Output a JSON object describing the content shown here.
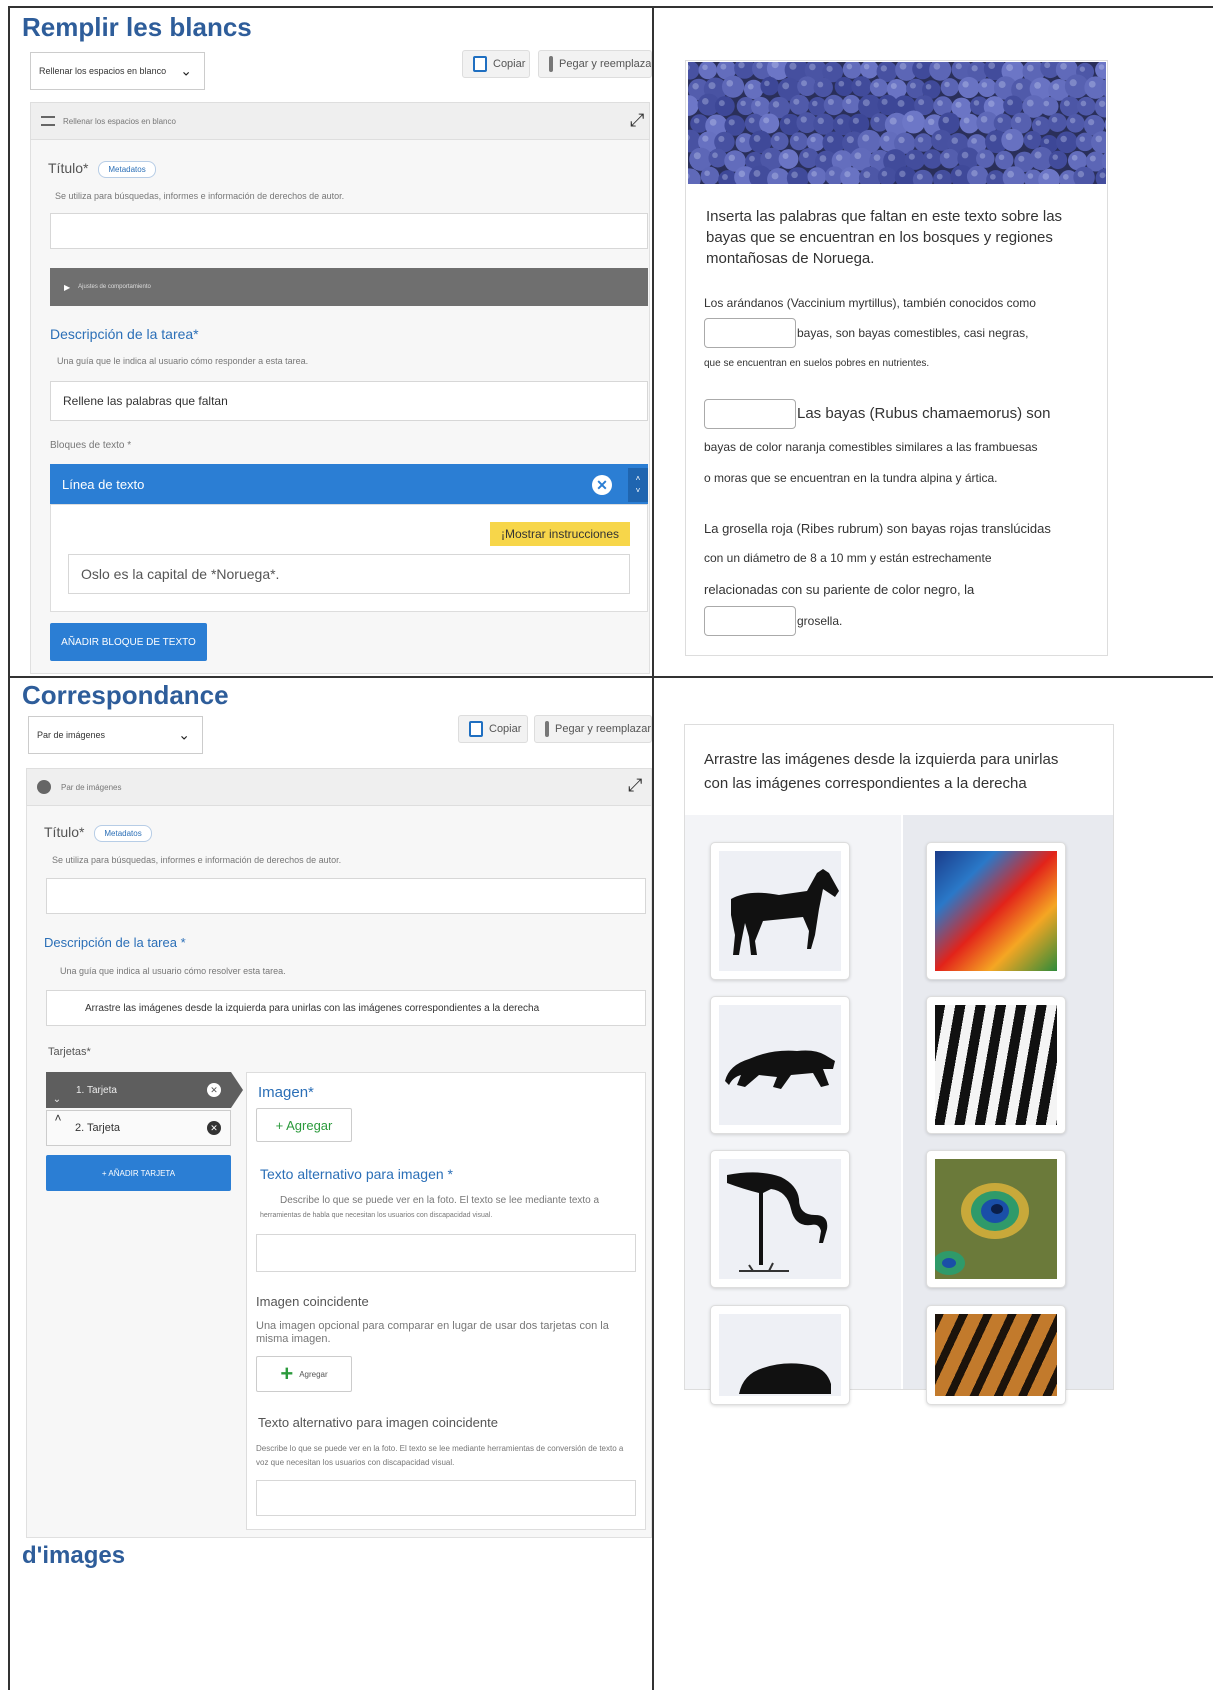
{
  "section1": {
    "title": "Remplir les blancs",
    "editor": {
      "select_value": "Rellenar los espacios en blanco",
      "copy_label": "Copiar",
      "paste_label": "Pegar y reemplazar",
      "header_label": "Rellenar los espacios en blanco",
      "title_label": "Título*",
      "metadata_label": "Metadatos",
      "title_hint": "Se utiliza para búsquedas, informes e información de derechos de autor.",
      "title_value": "",
      "settings_bar_label": "Ajustes de comportamiento",
      "task_desc_label": "Descripción de la tarea*",
      "task_desc_hint": "Una guía que le indica al usuario cómo responder a esta tarea.",
      "task_desc_value": "Rellene las palabras que faltan",
      "text_blocks_label": "Bloques de texto *",
      "text_line_label": "Línea de texto",
      "show_instructions_label": "¡Mostrar instrucciones",
      "text_line_value": "Oslo es la capital de *Noruega*.",
      "add_block_label": "AÑADIR BLOQUE DE TEXTO"
    },
    "preview": {
      "intro": "Inserta las palabras que faltan en este texto sobre las bayas que se encuentran en los bosques y regiones montañosas de Noruega.",
      "line1": "Los arándanos (Vaccinium myrtillus), también conocidos como",
      "line2": "bayas, son bayas comestibles, casi negras,",
      "line3": "que se encuentran en suelos pobres en nutrientes.",
      "line4": "Las bayas (Rubus chamaemorus) son",
      "line5": "bayas de color naranja comestibles similares a las frambuesas",
      "line6": "o moras que se encuentran en la tundra alpina y ártica.",
      "line7": "La grosella roja (Ribes rubrum) son bayas rojas translúcidas",
      "line8": "con un diámetro de 8 a 10 mm y están estrechamente",
      "line9": "relacionadas con su pariente de color negro, la",
      "line10": "grosella."
    }
  },
  "section2": {
    "title": "Correspondance",
    "footer_title": "d'images",
    "editor": {
      "select_value": "Par de imágenes",
      "copy_label": "Copiar",
      "paste_label": "Pegar y reemplazar",
      "header_label": "Par de imágenes",
      "title_label": "Título*",
      "metadata_label": "Metadatos",
      "title_hint": "Se utiliza para búsquedas, informes e información de derechos de autor.",
      "title_value": "",
      "task_desc_label": "Descripción de la tarea *",
      "task_desc_hint": "Una guía que indica al usuario cómo resolver esta tarea.",
      "task_desc_value": "Arrastre las imágenes desde la izquierda para unirlas con las imágenes correspondientes a la derecha",
      "cards_label": "Tarjetas*",
      "card1_label": "1. Tarjeta",
      "card2_label": "2. Tarjeta",
      "add_card_label": "+ AÑADIR TARJETA",
      "image_label": "Imagen*",
      "add_label": "+ Agregar",
      "alt_label": "Texto alternativo para imagen *",
      "alt_hint_1": "Describe lo que se puede ver en la foto. El texto se lee mediante texto a",
      "alt_hint_2": "herramientas de habla que necesitan los usuarios con discapacidad visual.",
      "matching_label": "Imagen coincidente",
      "matching_hint": "Una imagen opcional para comparar en lugar de usar dos tarjetas con la misma imagen.",
      "add_small_label": "Agregar",
      "matching_alt_label": "Texto alternativo para imagen coincidente",
      "matching_alt_hint": "Describe lo que se puede ver en la foto. El texto se lee mediante herramientas de conversión de texto a voz que necesitan los usuarios con discapacidad visual."
    },
    "preview": {
      "instructions": "Arrastre las imágenes desde la izquierda para unirlas con las imágenes correspondientes a la derecha"
    }
  }
}
